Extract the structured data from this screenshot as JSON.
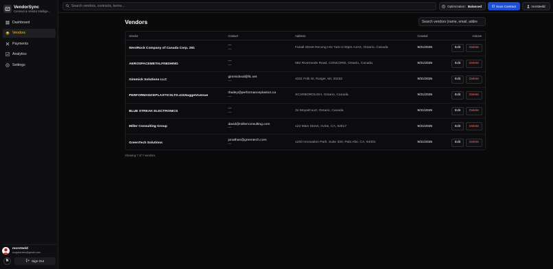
{
  "app": {
    "name": "VendorSync",
    "tagline": "Contract & Vendor Intellige..."
  },
  "sidebar": {
    "items": [
      {
        "label": "Dashboard",
        "icon": "dashboard-icon",
        "active": false
      },
      {
        "label": "Vendors",
        "icon": "vendors-icon",
        "active": true
      },
      {
        "label": "Payments",
        "icon": "payments-icon",
        "active": false
      },
      {
        "label": "Analytics",
        "icon": "analytics-icon",
        "active": false
      },
      {
        "label": "Settings",
        "icon": "settings-icon",
        "active": false
      }
    ],
    "user": {
      "name": "morsteeld",
      "email": "mogstantee@gmail.com"
    },
    "badge": "N",
    "sign_out": "Sign Out"
  },
  "topbar": {
    "search_placeholder": "Search vendors, contracts, terms...",
    "optimization_label": "Optimization:",
    "optimization_value": "Balanced",
    "scan_label": "Scan Contract",
    "user_label": "morsteeld"
  },
  "page": {
    "title": "Vendors",
    "search_placeholder": "Search vendors (name, email, addre",
    "columns": [
      "Vendor",
      "Contact",
      "Address",
      "Created",
      "Actions"
    ],
    "edit_label": "Edit",
    "delete_label": "Delete",
    "rows": [
      {
        "vendor": "WestRock Company of Canada Corp. 281",
        "contact1": "—",
        "contact2": "—",
        "address": "Fairall Street Recvng Hrs 7am-2:30pm AJAX, Ontario, Canada",
        "created": "9/21/2025"
      },
      {
        "vendor": "AEROSPACEMETALFINISHING",
        "contact1": "—",
        "contact2": "—",
        "address": "582 Rivermede Road, CONCORD, Ontario, Canada",
        "created": "9/21/2025"
      },
      {
        "vendor": "Gimmick Solutions LLC",
        "contact1": "gimmicksol@llc.net",
        "contact2": "—",
        "address": "4331 Folk St, Rutger, MI, 20232",
        "created": "9/21/2025"
      },
      {
        "vendor": "PERFORMANCEPLASTICSLTD.411NuggetAvenue",
        "contact1": "rbailey@performanceplastics.ca",
        "contact2": "—",
        "address": "SCARBOROUGH, Ontario, Canada.",
        "created": "9/21/2025"
      },
      {
        "vendor": "BLUE STREAK ELECTRONICS",
        "contact1": "—",
        "contact2": "—",
        "address": "3o MoyalCourt, Ontario, Canada",
        "created": "9/21/2025"
      },
      {
        "vendor": "Miller Consulting Group",
        "contact1": "david@millerconsulting.com",
        "contact2": "—",
        "address": "123 Main Street, Irvine, CA, 92617",
        "created": "9/21/2025"
      },
      {
        "vendor": "GreenTech Solutions",
        "contact1": "jonathan@greentech.com",
        "contact2": "—",
        "address": "1200 Innovation Park, Suite 300, Palo Alto, CA, 94301",
        "created": "9/21/2025"
      }
    ],
    "footer": "Showing 7 of 7 vendors."
  },
  "colors": {
    "accent": "#fbbf24",
    "primary": "#1d4ed8",
    "danger": "#f87171",
    "background": "#0a0a0b"
  }
}
